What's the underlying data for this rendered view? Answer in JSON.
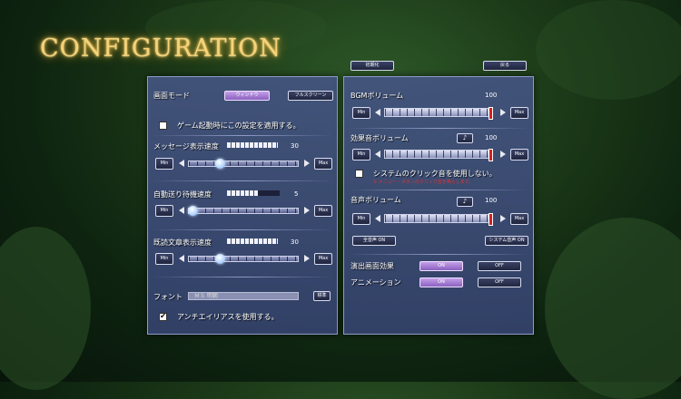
{
  "title": "CONFIGURATION",
  "top_buttons": {
    "init": "初期化",
    "back": "戻る"
  },
  "left": {
    "screen_mode_label": "画面モード",
    "window_btn": "ウィンドウ",
    "fullscreen_btn": "フルスクリーン",
    "startup_apply_label": "ゲーム起動時にこの設定を適用する。",
    "msg_speed_label": "メッセージ表示速度",
    "msg_speed_value": "30",
    "auto_wait_label": "自動送り待機速度",
    "auto_wait_value": "5",
    "read_speed_label": "既読文章表示速度",
    "read_speed_value": "30",
    "min": "Min",
    "max": "Max",
    "font_label": "フォント",
    "font_value": "ＭＳ 明朝",
    "font_std_btn": "標準",
    "antialias_label": "アンチエイリアスを使用する。",
    "antialias_check": "✔",
    "sliders": {
      "msg_speed": 0.3,
      "auto_wait": 0.0,
      "read_speed": 0.3
    },
    "dot_levels": {
      "msg_speed": 10,
      "auto_wait": 6,
      "read_speed": 10
    }
  },
  "right": {
    "bgm_label": "BGMボリューム",
    "bgm_value": "100",
    "se_label": "効果音ボリューム",
    "se_value": "100",
    "sys_click_label": "システムのクリック音を使用しない。",
    "sys_click_note": "※ メニュー・ボタンのクリック音を鳴らします。",
    "voice_label": "音声ボリューム",
    "voice_value": "100",
    "all_voice_on": "全音声 ON",
    "sys_voice_on": "システム音声 ON",
    "effect_label": "演出画面効果",
    "anim_label": "アニメーション",
    "on": "ON",
    "off": "OFF",
    "min": "Min",
    "max": "Max",
    "volumes": {
      "bgm": 1.0,
      "se": 1.0,
      "voice": 1.0
    }
  }
}
